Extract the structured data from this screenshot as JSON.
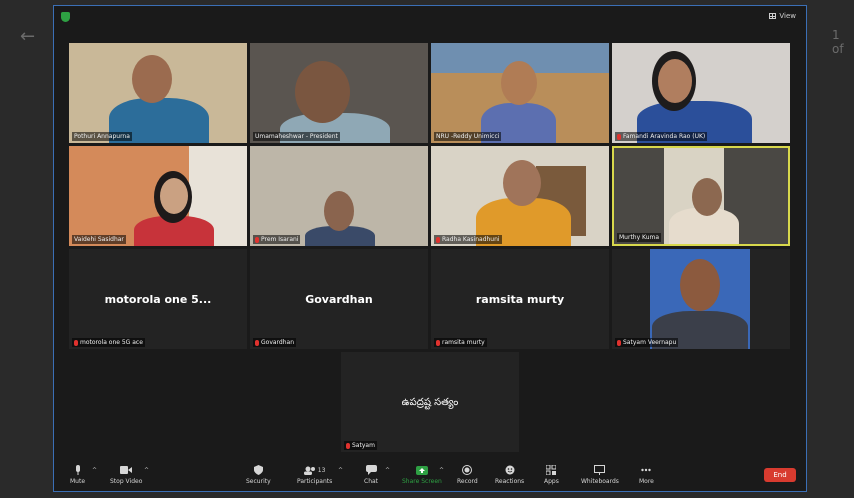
{
  "background": {
    "page_count": "1 of"
  },
  "header": {
    "view_label": "View"
  },
  "tiles": [
    {
      "name": "Pothuri Annapurna",
      "muted": false,
      "active": false
    },
    {
      "name": "Umamaheshwar - President",
      "muted": false,
      "active": false
    },
    {
      "name": "NRU -Reddy Unimicci",
      "muted": false,
      "active": false
    },
    {
      "name": "Famandi Aravinda Rao (UK)",
      "muted": true,
      "active": false
    },
    {
      "name": "Vaidehi Sasidhar",
      "muted": false,
      "active": false
    },
    {
      "name": "Prem Isarani",
      "muted": true,
      "active": false
    },
    {
      "name": "Radha Kasinadhuni",
      "muted": true,
      "active": false
    },
    {
      "name": "Murthy Kuma",
      "muted": false,
      "active": true
    },
    {
      "name": "motorola one 5G ace",
      "display": "motorola one 5...",
      "muted": true,
      "active": false
    },
    {
      "name": "Govardhan",
      "display": "Govardhan",
      "muted": true,
      "active": false
    },
    {
      "name": "ramsita murty",
      "display": "ramsita murty",
      "muted": true,
      "active": false
    },
    {
      "name": "Satyam Veernapu",
      "muted": true,
      "active": false
    },
    {
      "name": "Satyam",
      "display": "ఉపద్రష్ట సత్యం",
      "muted": true,
      "active": false
    }
  ],
  "toolbar": {
    "mute": "Mute",
    "stop_video": "Stop Video",
    "security": "Security",
    "participants": "Participants",
    "participants_count": "13",
    "chat": "Chat",
    "share_screen": "Share Screen",
    "record": "Record",
    "reactions": "Reactions",
    "apps": "Apps",
    "whiteboards": "Whiteboards",
    "more": "More",
    "end": "End"
  },
  "colors": {
    "accent_green": "#2ea043",
    "end_red": "#d83b2f",
    "active_border": "#d8d84c",
    "window_border": "#3b6fb6"
  }
}
